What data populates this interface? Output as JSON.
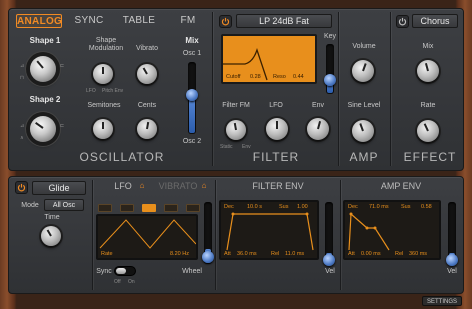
{
  "tabs": [
    {
      "label": "ANALOG",
      "active": true
    },
    {
      "label": "SYNC",
      "active": false
    },
    {
      "label": "TABLE",
      "active": false
    },
    {
      "label": "FM",
      "active": false
    }
  ],
  "oscillator": {
    "section_title": "OSCILLATOR",
    "shape1": "Shape 1",
    "shape2": "Shape 2",
    "shape_modulation": "Shape\nModulation",
    "vibrato": "Vibrato",
    "semitones": "Semitones",
    "cents": "Cents",
    "mix": "Mix",
    "osc1": "Osc 1",
    "osc2": "Osc 2",
    "mod_lfo": "LFO",
    "mod_pitch_env": "Pitch Env",
    "mix_level": 0.55
  },
  "filter": {
    "section_title": "FILTER",
    "type": "LP 24dB Fat",
    "key": "Key",
    "cutoff_label": "Cutoff",
    "cutoff_value": "0.28",
    "reso_label": "Reso",
    "reso_value": "0.44",
    "filter_fm": "Filter FM",
    "lfo": "LFO",
    "env": "Env",
    "fm_static": "Static",
    "fm_env": "Env",
    "key_level": 0.3
  },
  "amp": {
    "section_title": "AMP",
    "volume": "Volume",
    "sine_level": "Sine Level"
  },
  "effect": {
    "section_title": "EFFECT",
    "type": "Chorus",
    "mix": "Mix",
    "rate": "Rate"
  },
  "glide": {
    "label": "Glide",
    "mode_label": "Mode",
    "mode_value": "All Osc",
    "time_label": "Time"
  },
  "lfo": {
    "tab_lfo": "LFO",
    "tab_vibrato": "VIBRATO",
    "rate_label": "Rate",
    "rate_value": "8.20 Hz",
    "sync_label": "Sync",
    "off": "Off",
    "on": "On",
    "wheel": "Wheel"
  },
  "filter_env": {
    "title": "FILTER ENV",
    "dec_label": "Dec",
    "dec_value": "10.0 s",
    "sus_label": "Sus",
    "sus_value": "1.00",
    "att_label": "Att",
    "att_value": "36.0 ms",
    "rel_label": "Rel",
    "rel_value": "11.0 ms",
    "vel": "Vel"
  },
  "amp_env": {
    "title": "AMP ENV",
    "dec_label": "Dec",
    "dec_value": "71.0 ms",
    "sus_label": "Sus",
    "sus_value": "0.58",
    "att_label": "Att",
    "att_value": "0.00 ms",
    "rel_label": "Rel",
    "rel_value": "360 ms",
    "vel": "Vel"
  },
  "settings_label": "SETTINGS",
  "colors": {
    "accent": "#f08a24",
    "display": "#e88f1c",
    "slider": "#4a77c2"
  }
}
